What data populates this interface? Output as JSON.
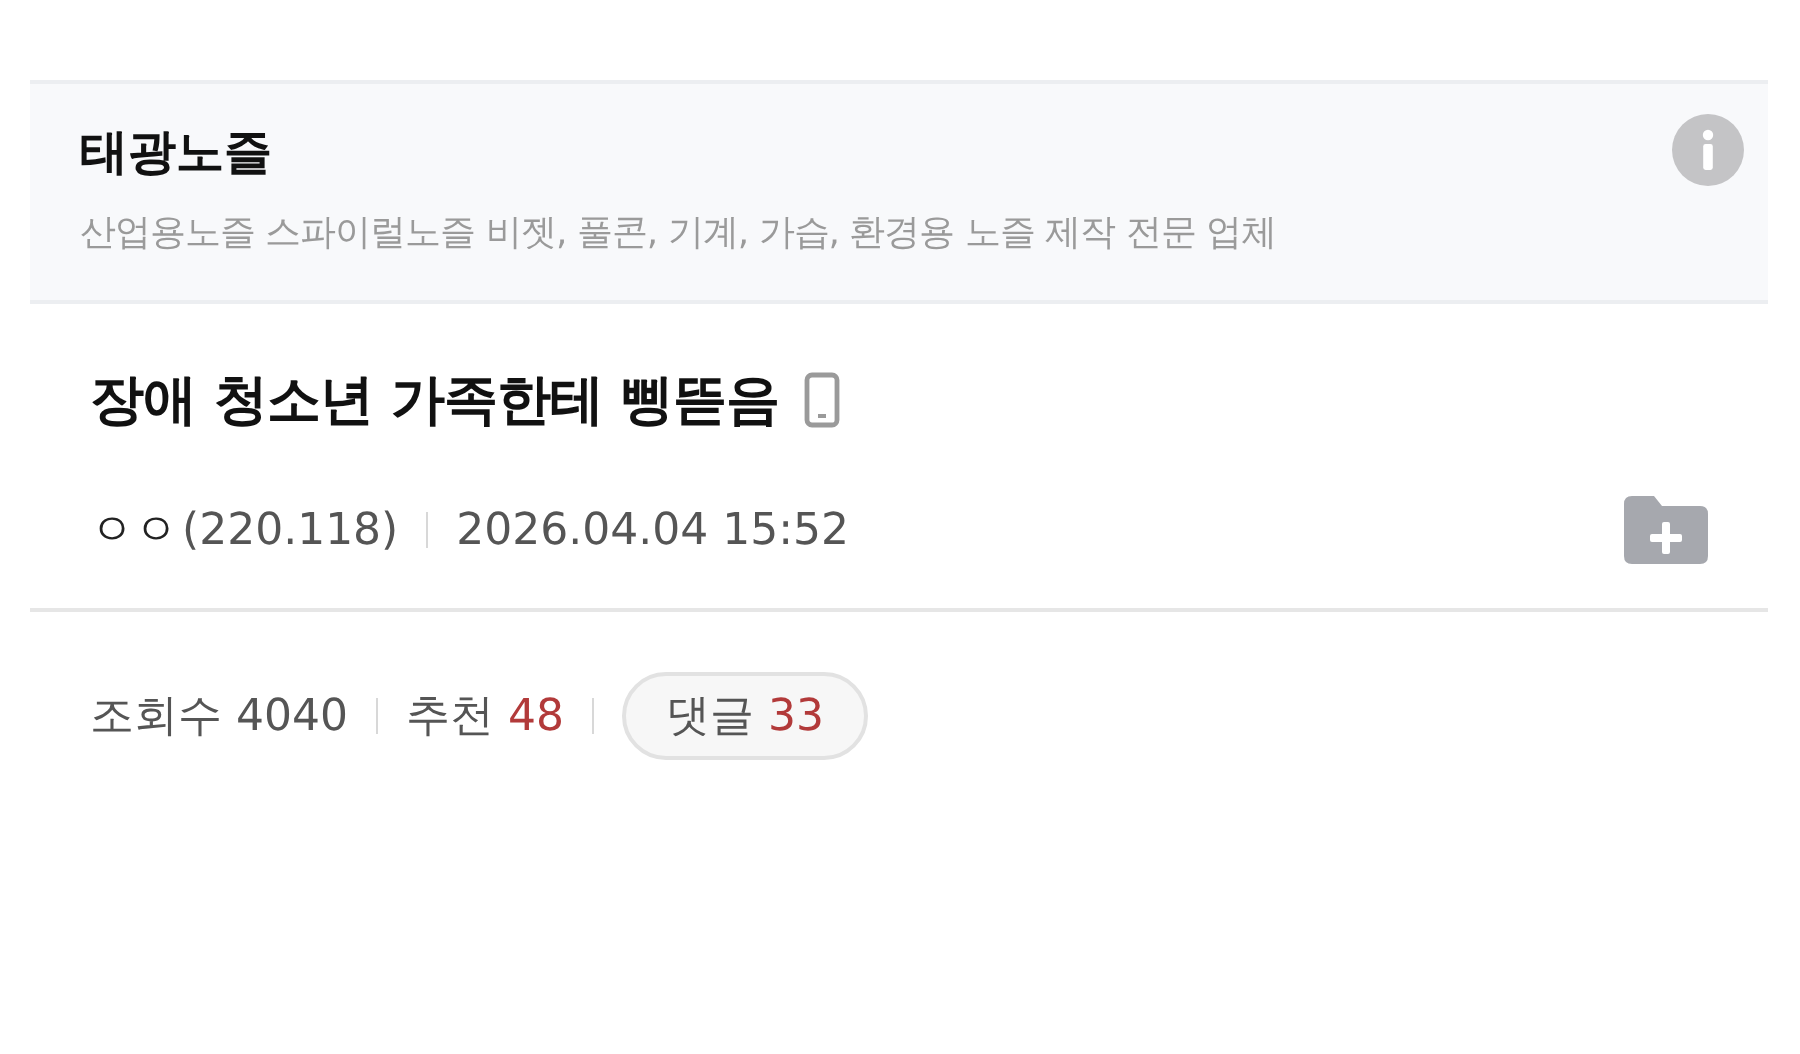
{
  "board": {
    "name": "태광노즐",
    "description": "산업용노즐 스파이럴노즐 비젯, 풀콘, 기계, 가습, 환경용 노즐 제작 전문 업체"
  },
  "post": {
    "title": "장애 청소년 가족한테 삥뜯음",
    "author": "ㅇㅇ",
    "ip": "(220.118)",
    "date": "2026.04.04 15:52"
  },
  "stats": {
    "views_label": "조회수",
    "views": "4040",
    "recommend_label": "추천",
    "recommend": "48",
    "comments_label": "댓글",
    "comments": "33"
  }
}
